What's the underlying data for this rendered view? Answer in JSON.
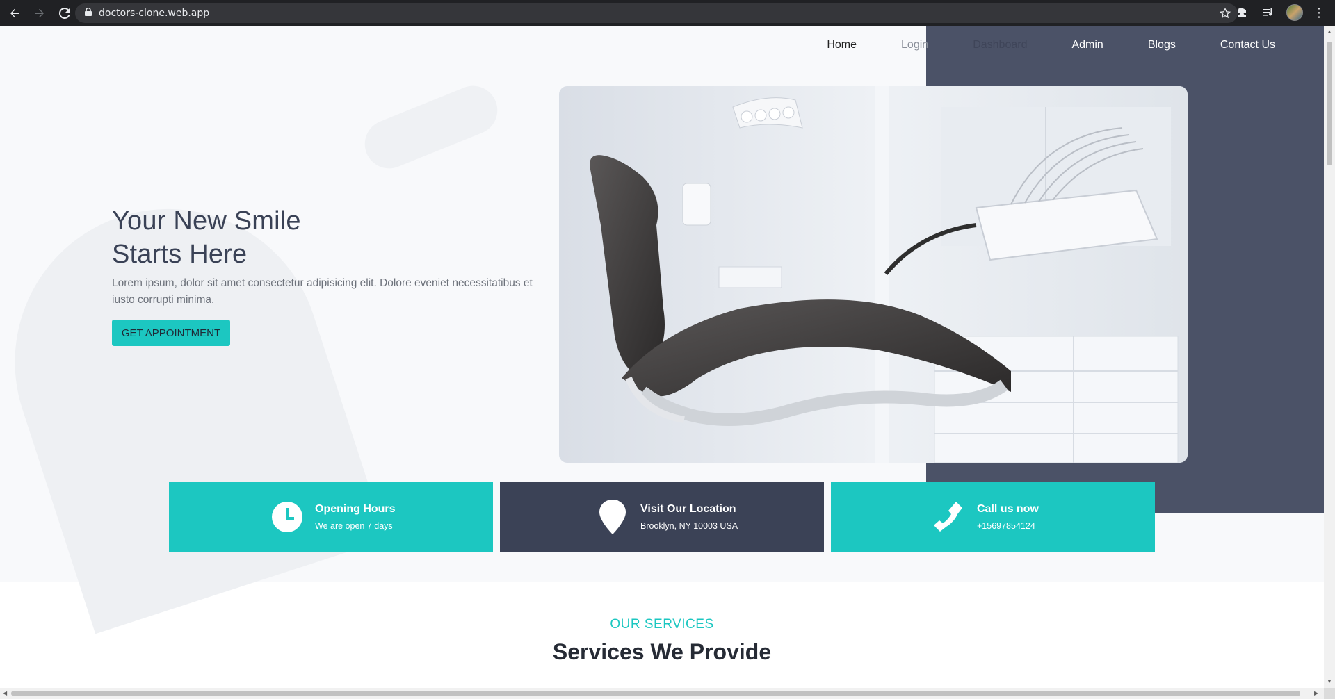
{
  "browser": {
    "url": "doctors-clone.web.app"
  },
  "nav": {
    "items": [
      {
        "label": "Home"
      },
      {
        "label": "Login"
      },
      {
        "label": "Dashboard"
      },
      {
        "label": "Admin"
      },
      {
        "label": "Blogs"
      },
      {
        "label": "Contact Us"
      }
    ]
  },
  "hero": {
    "title_line1": "Your New Smile",
    "title_line2": "Starts Here",
    "description": "Lorem ipsum, dolor sit amet consectetur adipisicing elit. Dolore eveniet necessitatibus et iusto corrupti minima.",
    "button_label": "GET APPOINTMENT"
  },
  "info_cards": [
    {
      "title": "Opening Hours",
      "subtitle": "We are open 7 days",
      "icon": "clock-icon",
      "color": "#1cc7c1"
    },
    {
      "title": "Visit Our Location",
      "subtitle": "Brooklyn, NY 10003 USA",
      "icon": "map-pin-icon",
      "color": "#3b4256"
    },
    {
      "title": "Call us now",
      "subtitle": "+15697854124",
      "icon": "phone-icon",
      "color": "#1cc7c1"
    }
  ],
  "services": {
    "subtitle": "OUR SERVICES",
    "title": "Services We Provide"
  },
  "colors": {
    "accent": "#1cc7c1",
    "dark": "#3b4256",
    "panel": "#4b5267"
  }
}
